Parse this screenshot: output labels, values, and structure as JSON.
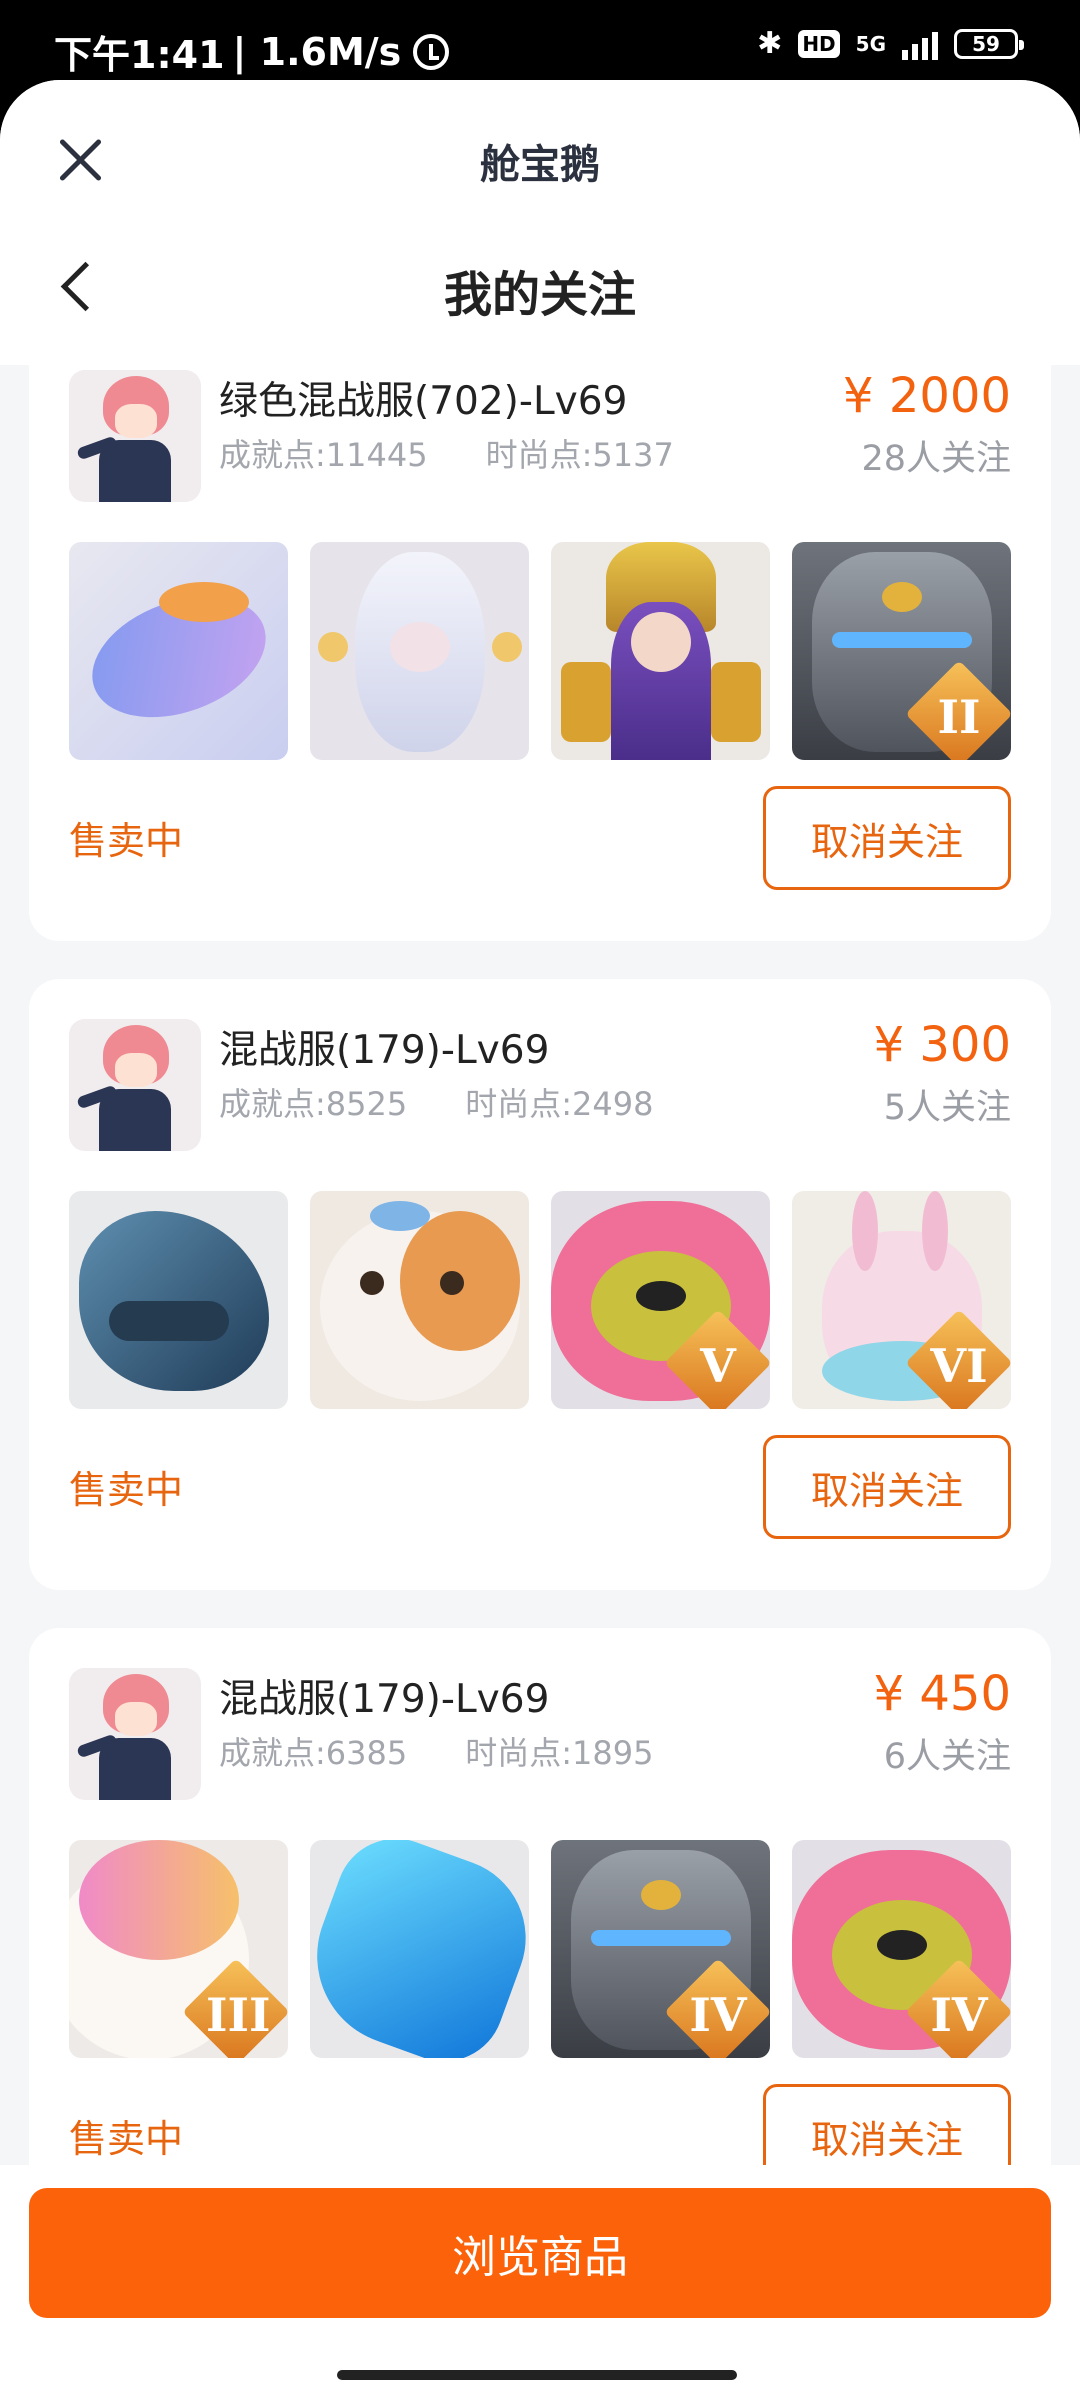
{
  "status_bar": {
    "time": "下午1:41",
    "speed": "| 1.6M/s",
    "bluetooth": "✱",
    "hd": "HD",
    "network": "5G",
    "battery": "59"
  },
  "header": {
    "app_title": "舱宝鹅",
    "page_title": "我的关注",
    "close_icon": "close-icon",
    "back_icon": "chevron-left-icon"
  },
  "accent_color": "#FB6209",
  "cards": [
    {
      "name": "绿色混战服(702)-Lv69",
      "achievement": "成就点:11445",
      "fashion": "时尚点:5137",
      "price": "¥ 2000",
      "followers": "28人关注",
      "status": "售卖中",
      "unfollow_label": "取消关注",
      "badges": [
        "",
        "",
        "",
        "II"
      ]
    },
    {
      "name": "混战服(179)-Lv69",
      "achievement": "成就点:8525",
      "fashion": "时尚点:2498",
      "price": "¥ 300",
      "followers": "5人关注",
      "status": "售卖中",
      "unfollow_label": "取消关注",
      "badges": [
        "",
        "",
        "V",
        "VI"
      ]
    },
    {
      "name": "混战服(179)-Lv69",
      "achievement": "成就点:6385",
      "fashion": "时尚点:1895",
      "price": "¥ 450",
      "followers": "6人关注",
      "status": "售卖中",
      "unfollow_label": "取消关注",
      "badges": [
        "III",
        "",
        "IV",
        "IV"
      ]
    }
  ],
  "footer": {
    "browse_label": "浏览商品"
  }
}
